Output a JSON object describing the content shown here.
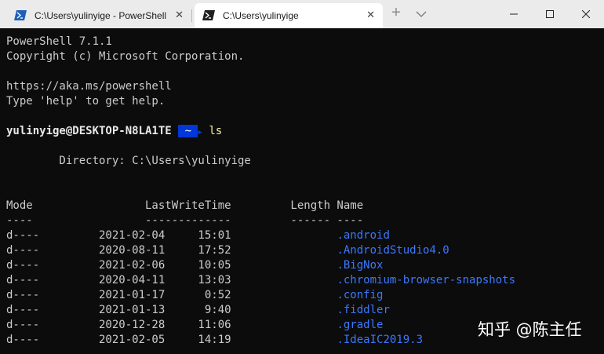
{
  "tabs": [
    {
      "title": "C:\\Users\\yulinyige - PowerShell",
      "close": "✕"
    },
    {
      "title": "C:\\Users\\yulinyige",
      "close": "✕"
    }
  ],
  "titlebar": {
    "new_tab": "+"
  },
  "terminal": {
    "banner": [
      "PowerShell 7.1.1",
      "Copyright (c) Microsoft Corporation.",
      "",
      "https://aka.ms/powershell",
      "Type 'help' to get help."
    ],
    "prompt": {
      "user": "yulinyige@DESKTOP-N8LA1TE",
      "dir": "~",
      "command": "ls"
    },
    "directory_line": "        Directory: C:\\Users\\yulinyige",
    "header": "Mode                 LastWriteTime         Length Name",
    "header_rule": "----                 -------------         ------ ----",
    "entries": [
      {
        "mode": "d----",
        "date": "2021-02-04",
        "time": "15:01",
        "name": ".android"
      },
      {
        "mode": "d----",
        "date": "2020-08-11",
        "time": "17:52",
        "name": ".AndroidStudio4.0"
      },
      {
        "mode": "d----",
        "date": "2021-02-06",
        "time": "10:05",
        "name": ".BigNox"
      },
      {
        "mode": "d----",
        "date": "2020-04-11",
        "time": "13:03",
        "name": ".chromium-browser-snapshots"
      },
      {
        "mode": "d----",
        "date": "2021-01-17",
        "time": "0:52",
        "name": ".config"
      },
      {
        "mode": "d----",
        "date": "2021-01-13",
        "time": "9:40",
        "name": ".fiddler"
      },
      {
        "mode": "d----",
        "date": "2020-12-28",
        "time": "11:06",
        "name": ".gradle"
      },
      {
        "mode": "d----",
        "date": "2021-02-05",
        "time": "14:19",
        "name": ".IdeaIC2019.3"
      }
    ]
  },
  "watermark": "知乎 @陈主任",
  "colors": {
    "background": "#0c0c0c",
    "text": "#cccccc",
    "dir_blue": "#3b78ff",
    "prompt_bg": "#0037da",
    "command": "#f9f1a5"
  }
}
